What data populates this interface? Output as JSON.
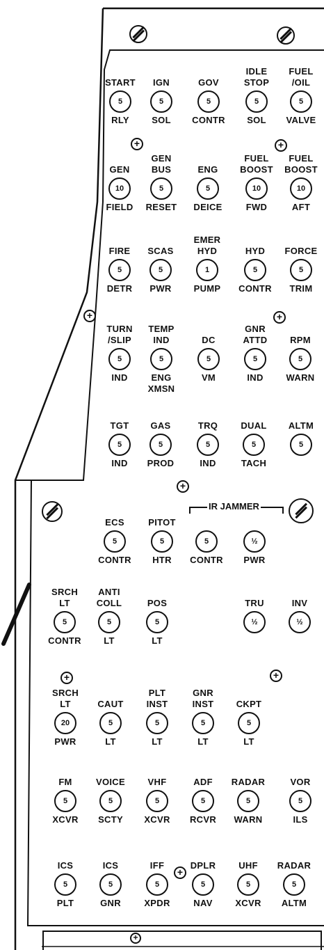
{
  "panel": {
    "ir_jammer_label": "IR JAMMER"
  },
  "breakers": [
    {
      "id": "start-rly",
      "top": [
        "START"
      ],
      "rating": "5",
      "bottom": [
        "RLY"
      ]
    },
    {
      "id": "ign-sol",
      "top": [
        "IGN"
      ],
      "rating": "5",
      "bottom": [
        "SOL"
      ]
    },
    {
      "id": "gov-contr",
      "top": [
        "GOV"
      ],
      "rating": "5",
      "bottom": [
        "CONTR"
      ]
    },
    {
      "id": "idle-stop-sol",
      "top": [
        "IDLE",
        "STOP"
      ],
      "rating": "5",
      "bottom": [
        "SOL"
      ]
    },
    {
      "id": "fuel-oil-valve",
      "top": [
        "FUEL",
        "/OIL"
      ],
      "rating": "5",
      "bottom": [
        "VALVE"
      ]
    },
    {
      "id": "gen-field",
      "top": [
        "GEN"
      ],
      "rating": "10",
      "bottom": [
        "FIELD"
      ]
    },
    {
      "id": "gen-bus-reset",
      "top": [
        "GEN",
        "BUS"
      ],
      "rating": "5",
      "bottom": [
        "RESET"
      ]
    },
    {
      "id": "eng-deice",
      "top": [
        "ENG"
      ],
      "rating": "5",
      "bottom": [
        "DEICE"
      ]
    },
    {
      "id": "fuel-boost-fwd",
      "top": [
        "FUEL",
        "BOOST"
      ],
      "rating": "10",
      "bottom": [
        "FWD"
      ]
    },
    {
      "id": "fuel-boost-aft",
      "top": [
        "FUEL",
        "BOOST"
      ],
      "rating": "10",
      "bottom": [
        "AFT"
      ]
    },
    {
      "id": "fire-detr",
      "top": [
        "FIRE"
      ],
      "rating": "5",
      "bottom": [
        "DETR"
      ]
    },
    {
      "id": "scas-pwr",
      "top": [
        "SCAS"
      ],
      "rating": "5",
      "bottom": [
        "PWR"
      ]
    },
    {
      "id": "emer-hyd-pump",
      "top": [
        "EMER",
        "HYD"
      ],
      "rating": "1",
      "bottom": [
        "PUMP"
      ]
    },
    {
      "id": "hyd-contr",
      "top": [
        "HYD"
      ],
      "rating": "5",
      "bottom": [
        "CONTR"
      ]
    },
    {
      "id": "force-trim",
      "top": [
        "FORCE"
      ],
      "rating": "5",
      "bottom": [
        "TRIM"
      ]
    },
    {
      "id": "turn-slip-ind",
      "top": [
        "TURN",
        "/SLIP"
      ],
      "rating": "5",
      "bottom": [
        "IND"
      ]
    },
    {
      "id": "temp-ind-eng-xmsn",
      "top": [
        "TEMP",
        "IND"
      ],
      "rating": "5",
      "bottom": [
        "ENG",
        "XMSN"
      ]
    },
    {
      "id": "dc-vm",
      "top": [
        "DC"
      ],
      "rating": "5",
      "bottom": [
        "VM"
      ]
    },
    {
      "id": "gnr-attd-ind",
      "top": [
        "GNR",
        "ATTD"
      ],
      "rating": "5",
      "bottom": [
        "IND"
      ]
    },
    {
      "id": "rpm-warn",
      "top": [
        "RPM"
      ],
      "rating": "5",
      "bottom": [
        "WARN"
      ]
    },
    {
      "id": "tgt-ind",
      "top": [
        "TGT"
      ],
      "rating": "5",
      "bottom": [
        "IND"
      ]
    },
    {
      "id": "gas-prod",
      "top": [
        "GAS"
      ],
      "rating": "5",
      "bottom": [
        "PROD"
      ]
    },
    {
      "id": "trq-ind",
      "top": [
        "TRQ"
      ],
      "rating": "5",
      "bottom": [
        "IND"
      ]
    },
    {
      "id": "dual-tach",
      "top": [
        "DUAL"
      ],
      "rating": "5",
      "bottom": [
        "TACH"
      ]
    },
    {
      "id": "altm",
      "top": [
        "ALTM"
      ],
      "rating": "5",
      "bottom": []
    },
    {
      "id": "ecs-contr",
      "top": [
        "ECS"
      ],
      "rating": "5",
      "bottom": [
        "CONTR"
      ]
    },
    {
      "id": "pitot-htr",
      "top": [
        "PITOT"
      ],
      "rating": "5",
      "bottom": [
        "HTR"
      ]
    },
    {
      "id": "ir-jammer-contr",
      "top": [],
      "rating": "5",
      "bottom": [
        "CONTR"
      ]
    },
    {
      "id": "ir-jammer-pwr",
      "top": [],
      "rating": "½",
      "bottom": [
        "PWR"
      ]
    },
    {
      "id": "srch-lt-contr",
      "top": [
        "SRCH",
        "LT"
      ],
      "rating": "5",
      "bottom": [
        "CONTR"
      ]
    },
    {
      "id": "anti-coll-lt",
      "top": [
        "ANTI",
        "COLL"
      ],
      "rating": "5",
      "bottom": [
        "LT"
      ]
    },
    {
      "id": "pos-lt",
      "top": [
        "POS"
      ],
      "rating": "5",
      "bottom": [
        "LT"
      ]
    },
    {
      "id": "tru",
      "top": [
        "TRU"
      ],
      "rating": "½",
      "bottom": []
    },
    {
      "id": "inv",
      "top": [
        "INV"
      ],
      "rating": "½",
      "bottom": []
    },
    {
      "id": "srch-lt-pwr",
      "top": [
        "SRCH",
        "LT"
      ],
      "rating": "20",
      "bottom": [
        "PWR"
      ]
    },
    {
      "id": "caut-lt",
      "top": [
        "CAUT"
      ],
      "rating": "5",
      "bottom": [
        "LT"
      ]
    },
    {
      "id": "plt-inst-lt",
      "top": [
        "PLT",
        "INST"
      ],
      "rating": "5",
      "bottom": [
        "LT"
      ]
    },
    {
      "id": "gnr-inst-lt",
      "top": [
        "GNR",
        "INST"
      ],
      "rating": "5",
      "bottom": [
        "LT"
      ]
    },
    {
      "id": "ckpt-lt",
      "top": [
        "CKPT"
      ],
      "rating": "5",
      "bottom": [
        "LT"
      ]
    },
    {
      "id": "fm-xcvr",
      "top": [
        "FM"
      ],
      "rating": "5",
      "bottom": [
        "XCVR"
      ]
    },
    {
      "id": "voice-scty",
      "top": [
        "VOICE"
      ],
      "rating": "5",
      "bottom": [
        "SCTY"
      ]
    },
    {
      "id": "vhf-xcvr",
      "top": [
        "VHF"
      ],
      "rating": "5",
      "bottom": [
        "XCVR"
      ]
    },
    {
      "id": "adf-rcvr",
      "top": [
        "ADF"
      ],
      "rating": "5",
      "bottom": [
        "RCVR"
      ]
    },
    {
      "id": "radar-warn",
      "top": [
        "RADAR"
      ],
      "rating": "5",
      "bottom": [
        "WARN"
      ]
    },
    {
      "id": "vor-ils",
      "top": [
        "VOR"
      ],
      "rating": "5",
      "bottom": [
        "ILS"
      ]
    },
    {
      "id": "ics-plt",
      "top": [
        "ICS"
      ],
      "rating": "5",
      "bottom": [
        "PLT"
      ]
    },
    {
      "id": "ics-gnr",
      "top": [
        "ICS"
      ],
      "rating": "5",
      "bottom": [
        "GNR"
      ]
    },
    {
      "id": "iff-xpdr",
      "top": [
        "IFF"
      ],
      "rating": "5",
      "bottom": [
        "XPDR"
      ]
    },
    {
      "id": "dplr-nav",
      "top": [
        "DPLR"
      ],
      "rating": "5",
      "bottom": [
        "NAV"
      ]
    },
    {
      "id": "uhf-xcvr",
      "top": [
        "UHF"
      ],
      "rating": "5",
      "bottom": [
        "XCVR"
      ]
    },
    {
      "id": "radar-altm",
      "top": [
        "RADAR"
      ],
      "rating": "5",
      "bottom": [
        "ALTM"
      ]
    }
  ]
}
